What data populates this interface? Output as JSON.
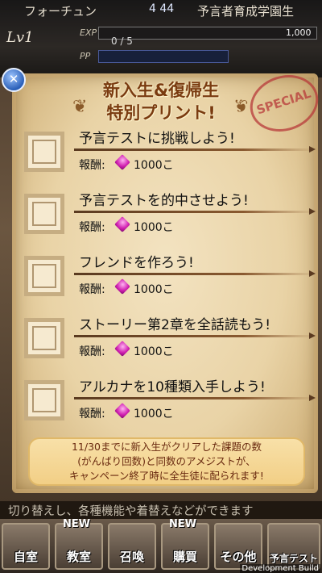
{
  "hud": {
    "tab_name": "フォーチュン",
    "center_value": "4 44",
    "school": "予言者育成学園生",
    "level": "Lv1",
    "exp_label": "EXP",
    "exp_value": "1,000",
    "exp_progress": "0 / 5",
    "pp_label": "PP"
  },
  "modal": {
    "title_line1": "新入生&復帰生",
    "title_line2": "特別プリント!",
    "stamp": "SPECIAL",
    "reward_label": "報酬:",
    "tasks": [
      {
        "title": "予言テストに挑戦しよう!",
        "reward": "1000こ"
      },
      {
        "title": "予言テストを的中させよう!",
        "reward": "1000こ"
      },
      {
        "title": "フレンドを作ろう!",
        "reward": "1000こ"
      },
      {
        "title": "ストーリー第2章を全話読もう!",
        "reward": "1000こ"
      },
      {
        "title": "アルカナを10種類入手しよう!",
        "reward": "1000こ"
      }
    ],
    "info_lines": [
      "11/30までに新入生がクリアした課題の数",
      "(がんばり回数)と同数のアメジストが、",
      "キャンペーン終了時に全生徒に配られます!"
    ]
  },
  "ticker": "切り替えし、各種機能や着替えなどができます",
  "nav": {
    "items": [
      "自室",
      "教室",
      "召喚",
      "購買",
      "その他",
      "予言テスト"
    ],
    "new_badge": "NEW"
  },
  "dev_build": "Development Build"
}
